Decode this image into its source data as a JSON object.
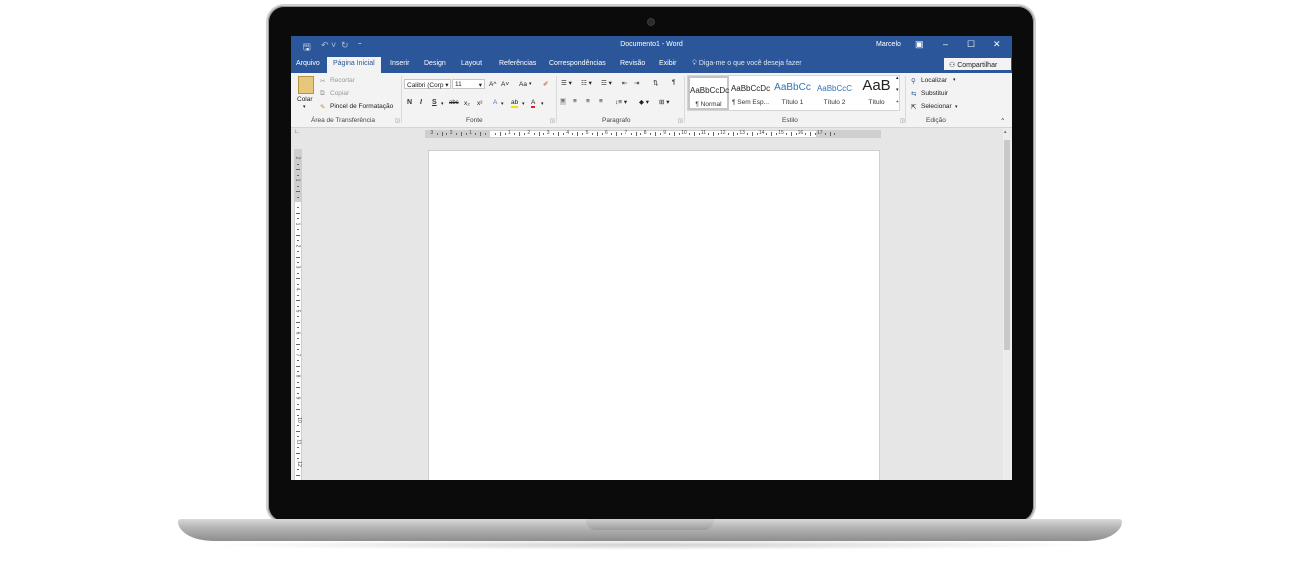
{
  "app": {
    "doc_title": "Documento1 - Word",
    "user": "Marcelo",
    "tell_me": "Diga-me o que você deseja fazer",
    "share": "Compartilhar"
  },
  "tabs": [
    "Arquivo",
    "Página Inicial",
    "Inserir",
    "Design",
    "Layout",
    "Referências",
    "Correspondências",
    "Revisão",
    "Exibir"
  ],
  "clipboard": {
    "paste": "Colar",
    "cut": "Recortar",
    "copy": "Copiar",
    "format_painter": "Pincel de Formatação",
    "label": "Área de Transferência"
  },
  "font": {
    "family": "Calibri (Corp",
    "size": "11",
    "label": "Fonte",
    "bold": "N",
    "italic": "I",
    "underline": "S",
    "strike": "abc",
    "subscript": "x₂",
    "superscript": "x²",
    "grow": "A^",
    "shrink": "A˅",
    "case": "Aa",
    "effects": "A",
    "highlight": "ab",
    "color": "A"
  },
  "paragraph": {
    "label": "Paragrafo",
    "pilcrow": "¶"
  },
  "styles": {
    "label": "Estilo",
    "items": [
      {
        "sample": "AaBbCcDc",
        "name": "¶ Normal"
      },
      {
        "sample": "AaBbCcDc",
        "name": "¶ Sem Esp..."
      },
      {
        "sample": "AaBbCc",
        "name": "Título 1"
      },
      {
        "sample": "AaBbCcC",
        "name": "Título 2"
      },
      {
        "sample": "AaB",
        "name": "Título"
      }
    ]
  },
  "editing": {
    "find": "Localizar",
    "replace": "Substituir",
    "select": "Selecionar",
    "label": "Edição"
  },
  "ruler": {
    "h_labels": [
      "3",
      "2",
      "1",
      "1",
      "2",
      "3",
      "4",
      "5",
      "6",
      "7",
      "8",
      "9",
      "10",
      "11",
      "12",
      "13",
      "14",
      "15",
      "16",
      "17"
    ],
    "v_labels": [
      "2",
      "1",
      "1",
      "2",
      "3",
      "4",
      "5",
      "6",
      "7",
      "8",
      "9",
      "10",
      "11",
      "12"
    ]
  }
}
